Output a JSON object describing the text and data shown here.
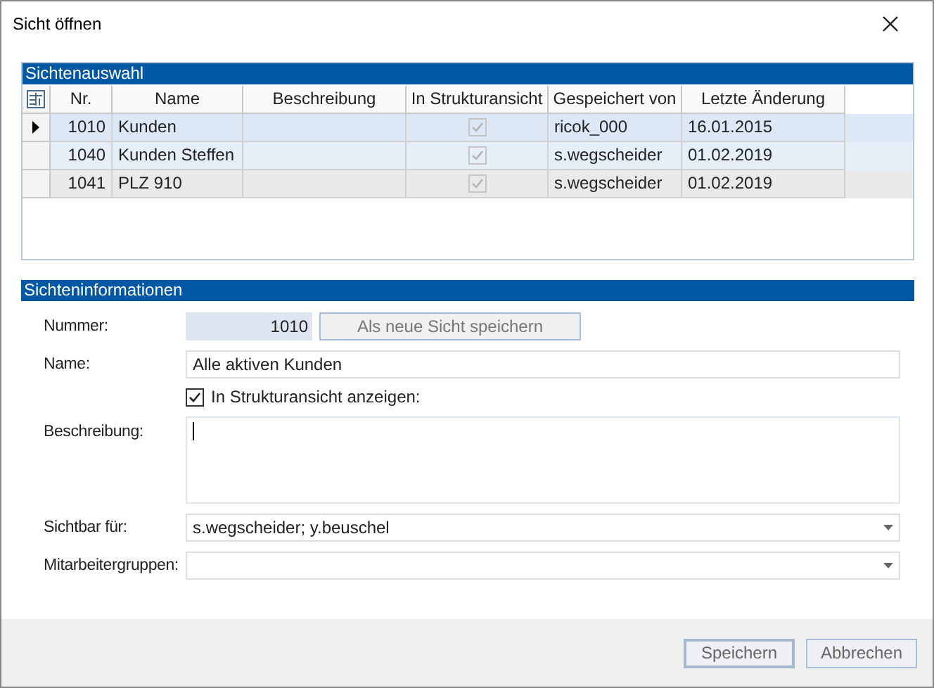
{
  "window": {
    "title": "Sicht öffnen"
  },
  "selection": {
    "title": "Sichtenauswahl",
    "columns": [
      "Nr.",
      "Name",
      "Beschreibung",
      "In Strukturansicht",
      "Gespeichert von",
      "Letzte Änderung"
    ],
    "rows": [
      {
        "selected": true,
        "nr": "1010",
        "name": "Kunden",
        "in_structure": true,
        "saved_by": "ricok_000",
        "changed": "16.01.2015"
      },
      {
        "selected": false,
        "nr": "1040",
        "name": "Kunden Steffen",
        "in_structure": true,
        "saved_by": "s.wegscheider",
        "changed": "01.02.2019"
      },
      {
        "selected": false,
        "nr": "1041",
        "name": "PLZ 910",
        "in_structure": true,
        "saved_by": "s.wegscheider",
        "changed": "01.02.2019"
      }
    ]
  },
  "info": {
    "title": "Sichteninformationen",
    "number": {
      "label": "Nummer:",
      "value": "1010"
    },
    "save_new_button": "Als neue Sicht speichern",
    "name": {
      "label": "Name:",
      "value": "Alle aktiven Kunden"
    },
    "structure_checkbox": {
      "label": "In Strukturansicht anzeigen:",
      "checked": true
    },
    "description": {
      "label": "Beschreibung:"
    },
    "visible_for": {
      "label": "Sichtbar für:",
      "value": "s.wegscheider; y.beuschel"
    },
    "groups": {
      "label": "Mitarbeitergruppen:"
    }
  },
  "buttons": [
    {
      "label": "Speichern",
      "disabled": false
    },
    {
      "label": "Abbrechen",
      "disabled": false
    }
  ]
}
